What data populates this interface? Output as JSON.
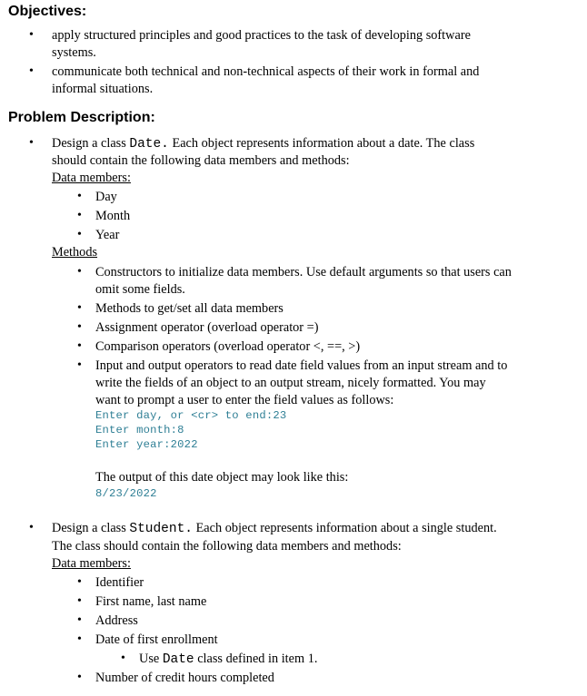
{
  "objectives": {
    "heading": "Objectives:",
    "items": [
      {
        "lines": [
          "apply structured principles and good practices to the task of developing software",
          "systems."
        ]
      },
      {
        "lines": [
          "communicate both technical and non-technical aspects of their work in formal and",
          "informal situations."
        ]
      }
    ]
  },
  "problem": {
    "heading": "Problem Description:",
    "date_class": {
      "intro_prefix": "Design a class ",
      "class_name": "Date.",
      "intro_suffix": " Each object represents information about a date. The class",
      "intro_line2": "should contain the following data members and methods:",
      "data_members_label": "Data members:",
      "data_members": [
        "Day",
        "Month",
        "Year"
      ],
      "methods_label": "Methods",
      "methods": [
        {
          "lines": [
            "Constructors to initialize data members. Use default arguments so that users can",
            "omit some fields."
          ]
        },
        {
          "lines": [
            "Methods to get/set all data members"
          ]
        },
        {
          "lines": [
            "Assignment operator (overload operator =)"
          ]
        },
        {
          "lines": [
            "Comparison operators (overload operator <, ==, >)"
          ]
        },
        {
          "lines": [
            "Input and output operators to read date field values from an input stream and to",
            "write the fields of an object to an output stream, nicely formatted. You may",
            "want to prompt a user to enter the field values as follows:"
          ]
        }
      ],
      "console_prompt": [
        "Enter day, or <cr> to end:23",
        "Enter month:8",
        "Enter year:2022"
      ],
      "output_intro": "The output of this date object may look like this:",
      "output_example": "8/23/2022"
    },
    "student_class": {
      "intro_prefix": "Design a class ",
      "class_name": "Student.",
      "intro_suffix": " Each object represents information about a single student.",
      "intro_line2": "The class should contain the following data members and methods:",
      "data_members_label": "Data members:",
      "data_members": [
        "Identifier",
        "First name, last name",
        "Address",
        "Date of first enrollment"
      ],
      "sub_item": {
        "prefix": "Use ",
        "code": "Date",
        "suffix": " class defined in item 1."
      },
      "last_member": "Number of credit hours completed"
    }
  },
  "colors": {
    "console_text": "#2f7f95",
    "text": "#000000",
    "background": "#ffffff"
  }
}
